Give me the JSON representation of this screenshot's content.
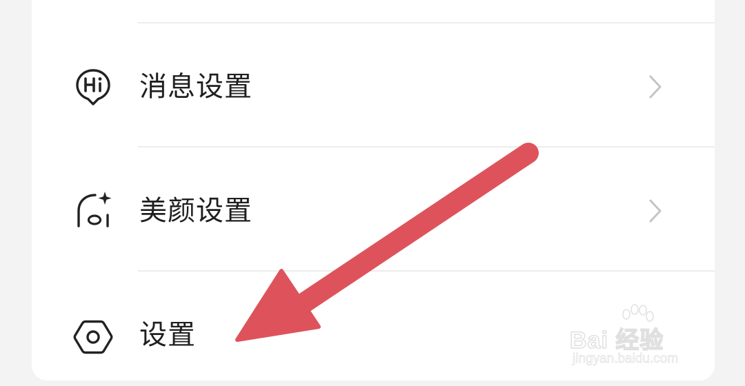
{
  "settings_list": {
    "items": [
      {
        "label": "消息设置",
        "icon": "hi-bubble-icon",
        "has_chevron": true
      },
      {
        "label": "美颜设置",
        "icon": "beauty-sparkle-icon",
        "has_chevron": true
      },
      {
        "label": "设置",
        "icon": "hexagon-gear-icon",
        "has_chevron": false
      }
    ]
  },
  "annotation": {
    "arrow_color": "#de535b",
    "points_to": "设置"
  },
  "watermark": {
    "brand": "Bai 经验",
    "site": "jingyan.baidu.com"
  },
  "colors": {
    "background": "#f3f3f3",
    "card": "#ffffff",
    "text": "#1f1f1f",
    "chevron": "#c4c4c4",
    "divider": "#ececec"
  }
}
